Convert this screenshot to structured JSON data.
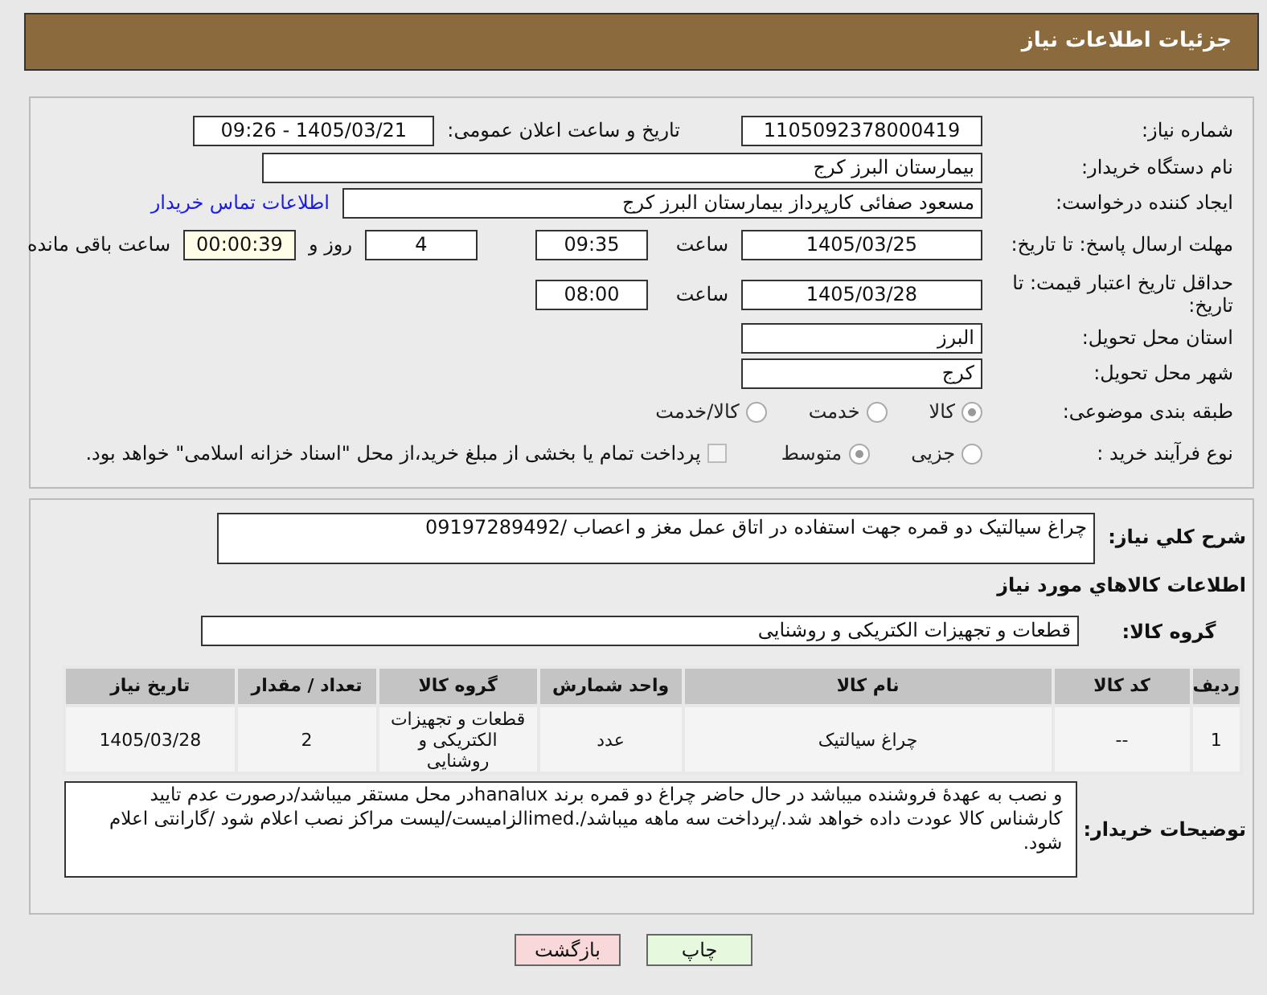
{
  "header": {
    "title": "جزئیات اطلاعات نیاز"
  },
  "fields": {
    "need_number": {
      "label": "شماره نیاز:",
      "value": "1105092378000419"
    },
    "announce": {
      "label": "تاریخ و ساعت اعلان عمومی:",
      "value": "1405/03/21 - 09:26"
    },
    "buyer": {
      "label": "نام دستگاه خریدار:",
      "value": "بیمارستان البرز کرج"
    },
    "requester": {
      "label": "ایجاد کننده درخواست:",
      "value": "مسعود صفائی کارپرداز بیمارستان البرز کرج",
      "link": "اطلاعات تماس خریدار"
    },
    "deadline": {
      "label": "مهلت ارسال پاسخ: تا تاریخ:",
      "date": "1405/03/25",
      "time_label": "ساعت",
      "time": "09:35",
      "days": "4",
      "days_label": "روز و",
      "remaining": "00:00:39",
      "remaining_label": "ساعت باقی مانده"
    },
    "validity": {
      "label": "حداقل تاریخ اعتبار قیمت: تا تاریخ:",
      "date": "1405/03/28",
      "time_label": "ساعت",
      "time": "08:00"
    },
    "province": {
      "label": "استان محل تحویل:",
      "value": "البرز"
    },
    "city": {
      "label": "شهر محل تحویل:",
      "value": "کرج"
    },
    "category": {
      "label": "طبقه بندی موضوعی:",
      "options": [
        {
          "label": "کالا",
          "selected": true
        },
        {
          "label": "خدمت",
          "selected": false
        },
        {
          "label": "کالا/خدمت",
          "selected": false
        }
      ]
    },
    "process": {
      "label": "نوع فرآیند خرید :",
      "options": [
        {
          "label": "جزیی",
          "selected": false
        },
        {
          "label": "متوسط",
          "selected": true
        }
      ],
      "payment": {
        "label": "پرداخت تمام یا بخشی از مبلغ خرید،از محل \"اسناد خزانه اسلامی\" خواهد بود.",
        "checked": false
      }
    }
  },
  "description": {
    "label": "شرح کلي نياز:",
    "value": "چراغ سیالتیک دو قمره جهت استفاده در اتاق عمل مغز و اعصاب /09197289492"
  },
  "goods_title": "اطلاعات کالاهاي مورد نياز",
  "goods_group": {
    "label": "گروه کالا:",
    "value": "قطعات و تجهیزات الکتریکی و روشنایی"
  },
  "table": {
    "columns": [
      "ردیف",
      "کد کالا",
      "نام کالا",
      "واحد شمارش",
      "گروه کالا",
      "تعداد / مقدار",
      "تاریخ نیاز"
    ],
    "rows": [
      [
        "1",
        "--",
        "چراغ سیالتیک",
        "عدد",
        "قطعات و تجهیزات الکتریکی و روشنایی",
        "2",
        "1405/03/28"
      ]
    ]
  },
  "notes": {
    "label": "توضیحات خریدار:",
    "value": "و نصب به عهدهٔ فروشنده میباشد در حال حاضر چراغ دو قمره برند hanaluxدر محل مستقر میباشد/درصورت عدم تایید کارشناس کالا عودت داده خواهد شد./پرداخت سه ماهه میباشد/.imedالزامیست/لیست مراکز نصب اعلام شود /گارانتی اعلام شود."
  },
  "buttons": [
    {
      "label": "چاپ",
      "kind": "print"
    },
    {
      "label": "بازگشت",
      "kind": "back"
    }
  ]
}
